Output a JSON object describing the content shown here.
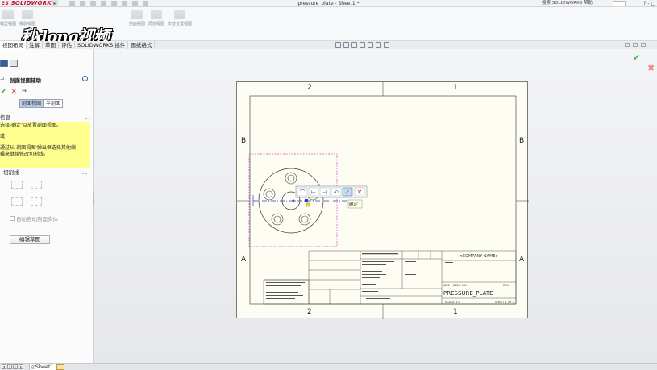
{
  "titlebar": {
    "logo": "SOLIDWORKS",
    "document_title": "pressure_plate - Sheet1 *",
    "search_label": "搜索 SOLIDWORKS 帮助",
    "window_controls": "? - □"
  },
  "watermark": "秒dong视频",
  "ribbon": {
    "items": [
      "模型视图",
      "投影视图",
      "剖面视图",
      "局部视图",
      "断开的剖视图",
      "交替位置视图"
    ]
  },
  "tabs": [
    {
      "label": "视图布局",
      "active": true
    },
    {
      "label": "注解",
      "active": false
    },
    {
      "label": "草图",
      "active": false
    },
    {
      "label": "评估",
      "active": false
    },
    {
      "label": "SOLIDWORKS 插件",
      "active": false
    },
    {
      "label": "图纸格式",
      "active": false
    }
  ],
  "property_manager": {
    "title": "剖面视图辅助",
    "segments": [
      "剖面视图",
      "半剖面"
    ],
    "info_header": "信息",
    "info_lines": [
      "选择-确定'以放置剖面视图。",
      "或",
      "通过从-剖面视图'弹出框选择其他编",
      "辑来继续修改切割线。"
    ],
    "cut_line_header": "切割线",
    "auto_checkbox": "自动启动剖面实体",
    "edit_sketch_button": "编辑草图"
  },
  "sheet": {
    "zones_top": [
      "2",
      "1"
    ],
    "zones_bottom": [
      "2",
      "1"
    ],
    "zones_side": [
      "B",
      "A"
    ],
    "company_name": "<COMPANY NAME>",
    "drawing_title": "PRESSURE_PLATE",
    "size_label": "SIZE",
    "size_value": "A",
    "dwg_no_label": "DWG. NO.",
    "rev_label": "REV",
    "scale_label": "SCALE: 1:2",
    "sheet_label": "SHEET 1 OF 1",
    "title_label": "TITLE:"
  },
  "popup": {
    "tooltip": "确定"
  },
  "statusbar": {
    "sheet_tab": "Sheet1"
  },
  "colors": {
    "accent": "#2f5f9e",
    "info_bg": "#ffff8f",
    "selection_box": "#e040c8",
    "cut_line": "#2540d0"
  }
}
